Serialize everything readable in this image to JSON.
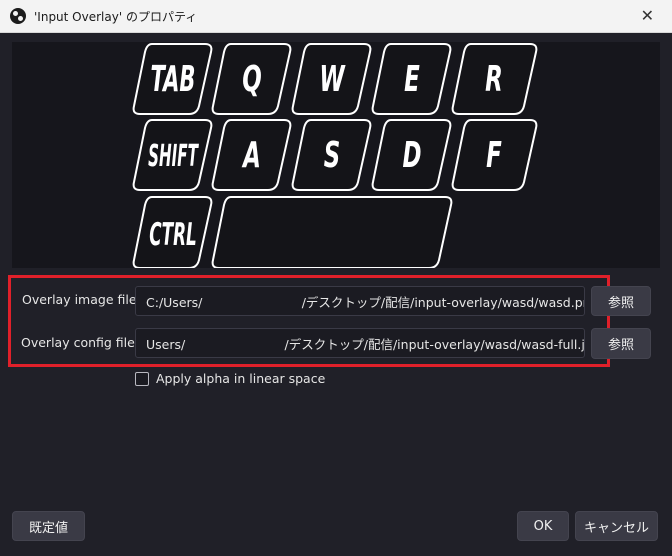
{
  "window": {
    "title": "'Input Overlay' のプロパティ",
    "close_glyph": "✕"
  },
  "preview": {
    "keys": {
      "tab": "TAB",
      "q": "Q",
      "w": "W",
      "e": "E",
      "r": "R",
      "shift": "SHIFT",
      "a": "A",
      "s": "S",
      "d": "D",
      "f": "F",
      "ctrl": "CTRL",
      "space": ""
    }
  },
  "image_file": {
    "label": "Overlay image file",
    "value": "C:/Users/                         /デスクトップ/配信/input-overlay/wasd/wasd.png",
    "browse_label": "参照"
  },
  "config_file": {
    "label": "Overlay config file",
    "value": "Users/                         /デスクトップ/配信/input-overlay/wasd/wasd-full.json",
    "browse_label": "参照"
  },
  "linear_alpha": {
    "label": "Apply alpha in linear space",
    "checked": false
  },
  "footer": {
    "defaults_label": "既定値",
    "ok_label": "OK",
    "cancel_label": "キャンセル"
  },
  "colors": {
    "highlight": "#e0202a",
    "background": "#202028",
    "preview_background": "#16161c"
  }
}
